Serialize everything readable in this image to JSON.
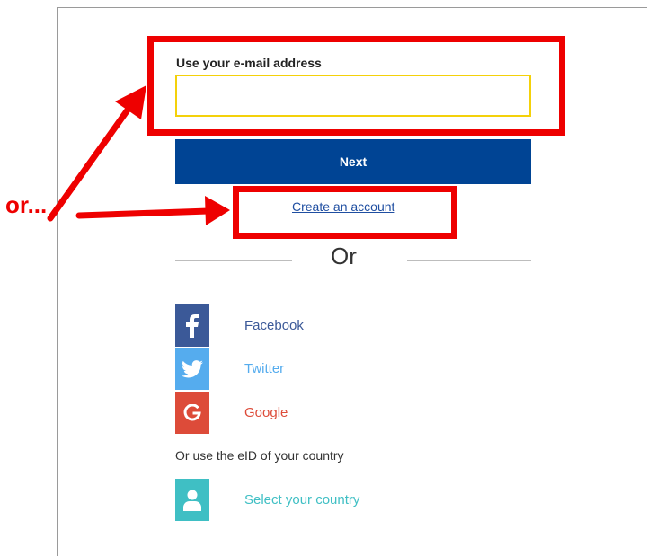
{
  "form": {
    "email_label": "Use your e-mail address",
    "email_value": "",
    "next_label": "Next",
    "create_account_label": "Create an account",
    "or_divider": "Or"
  },
  "social": [
    {
      "label": "Facebook",
      "icon": "facebook-icon",
      "color": "#3b5998"
    },
    {
      "label": "Twitter",
      "icon": "twitter-icon",
      "color": "#55acee"
    },
    {
      "label": "Google",
      "icon": "google-icon",
      "color": "#dd4b39"
    }
  ],
  "eid": {
    "prompt": "Or use the eID of your country",
    "select_label": "Select your country",
    "color": "#3fbfc4"
  },
  "annotation": {
    "or_text": "or...",
    "color": "#ee0000"
  },
  "colors": {
    "primary_button": "#004494",
    "input_focus_border": "#f4d10a",
    "link": "#1f4ea1"
  }
}
